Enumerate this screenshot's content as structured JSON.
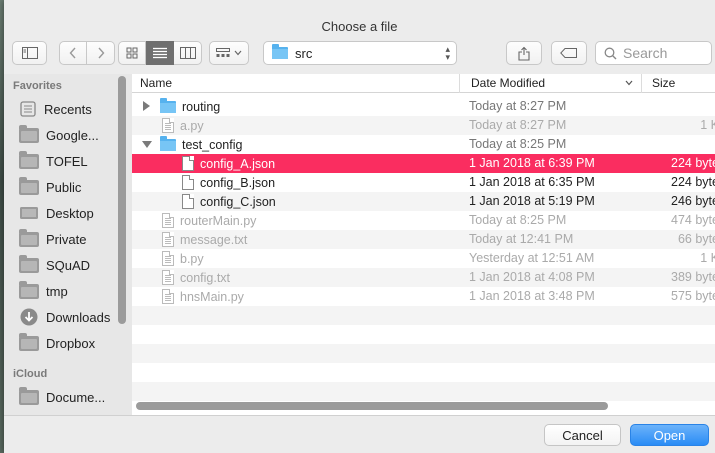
{
  "dialog": {
    "title": "Choose a file"
  },
  "toolbar": {
    "path": "src",
    "search_placeholder": "Search"
  },
  "sidebar": {
    "favorites_header": "Favorites",
    "icloud_header": "iCloud",
    "items": [
      {
        "label": "Recents",
        "icon": "recents-icon"
      },
      {
        "label": "Google...",
        "icon": "folder-icon"
      },
      {
        "label": "TOFEL",
        "icon": "folder-icon"
      },
      {
        "label": "Public",
        "icon": "folder-icon"
      },
      {
        "label": "Desktop",
        "icon": "desktop-icon"
      },
      {
        "label": "Private",
        "icon": "folder-icon"
      },
      {
        "label": "SQuAD",
        "icon": "folder-icon"
      },
      {
        "label": "tmp",
        "icon": "folder-icon"
      },
      {
        "label": "Downloads",
        "icon": "downloads-icon"
      },
      {
        "label": "Dropbox",
        "icon": "folder-icon"
      }
    ],
    "icloud_items": [
      {
        "label": "Docume...",
        "icon": "documents-icon"
      }
    ]
  },
  "columns": {
    "name": "Name",
    "date": "Date Modified",
    "size": "Size"
  },
  "files": [
    {
      "name": "routing",
      "date": "Today at 8:27 PM",
      "size": "-",
      "kind": "folder",
      "disclosure": "collapsed",
      "indent": 0,
      "dim": false
    },
    {
      "name": "a.py",
      "date": "Today at 8:27 PM",
      "size": "1 K",
      "kind": "file",
      "indent": 0,
      "dim": true
    },
    {
      "name": "test_config",
      "date": "Today at 8:25 PM",
      "size": "-",
      "kind": "folder",
      "disclosure": "expanded",
      "indent": 0,
      "dim": false
    },
    {
      "name": "config_A.json",
      "date": "1 Jan 2018 at 6:39 PM",
      "size": "224 byte",
      "kind": "file",
      "indent": 1,
      "dim": false,
      "selected": true
    },
    {
      "name": "config_B.json",
      "date": "1 Jan 2018 at 6:35 PM",
      "size": "224 byte",
      "kind": "file",
      "indent": 1,
      "dim": false
    },
    {
      "name": "config_C.json",
      "date": "1 Jan 2018 at 5:19 PM",
      "size": "246 byte",
      "kind": "file",
      "indent": 1,
      "dim": false
    },
    {
      "name": "routerMain.py",
      "date": "Today at 8:25 PM",
      "size": "474 byte",
      "kind": "file",
      "indent": 0,
      "dim": true
    },
    {
      "name": "message.txt",
      "date": "Today at 12:41 PM",
      "size": "66 byte",
      "kind": "file",
      "indent": 0,
      "dim": true
    },
    {
      "name": "b.py",
      "date": "Yesterday at 12:51 AM",
      "size": "1 K",
      "kind": "file",
      "indent": 0,
      "dim": true
    },
    {
      "name": "config.txt",
      "date": "1 Jan 2018 at 4:08 PM",
      "size": "389 byte",
      "kind": "file",
      "indent": 0,
      "dim": true
    },
    {
      "name": "hnsMain.py",
      "date": "1 Jan 2018 at 3:48 PM",
      "size": "575 byte",
      "kind": "file",
      "indent": 0,
      "dim": true
    }
  ],
  "buttons": {
    "cancel": "Cancel",
    "open": "Open"
  },
  "colors": {
    "selection": "#fa2d60",
    "accent": "#2a8cf5",
    "folder": "#56b2ee"
  }
}
